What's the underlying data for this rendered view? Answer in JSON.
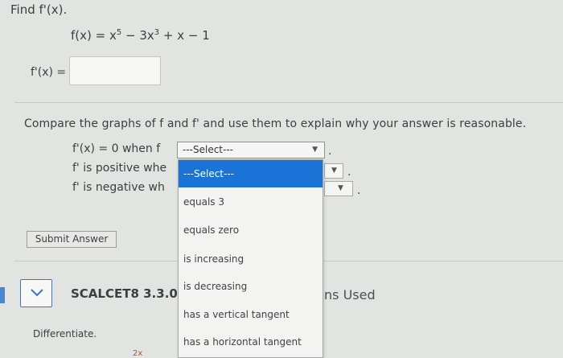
{
  "question": {
    "prompt": "Find f'(x).",
    "function": {
      "lhs": "f(x) = x",
      "exp1": "5",
      "mid": " − 3x",
      "exp2": "3",
      "rhs": " + x − 1"
    },
    "answer_label": "f'(x) ="
  },
  "compare": {
    "text": "Compare the graphs of f and f' and use them to explain why your answer is reasonable.",
    "row1": "f'(x) = 0 when f",
    "row2": "f' is positive whe",
    "row3": "f' is negative wh",
    "select_value": "---Select---",
    "period": "."
  },
  "dropdown": {
    "options": [
      "---Select---",
      "equals 3",
      "equals zero",
      "is increasing",
      "is decreasing",
      "has a vertical tangent",
      "has a horizontal tangent"
    ]
  },
  "submit_label": "Submit Answer",
  "next": {
    "title": "SCALCET8 3.3.0(",
    "used": "ns Used",
    "instruction": "Differentiate.",
    "partial": "2x"
  },
  "colors": {
    "accent": "#1a73d6",
    "background": "#e2e4e1"
  }
}
